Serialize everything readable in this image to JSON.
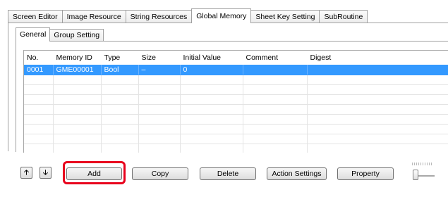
{
  "main_tabs": [
    "Screen Editor",
    "Image Resource",
    "String Resources",
    "Global Memory",
    "Sheet Key Setting",
    "SubRoutine"
  ],
  "active_main_tab": "Global Memory",
  "sub_tabs": [
    "General",
    "Group Setting"
  ],
  "active_sub_tab": "General",
  "grid": {
    "columns": [
      "No.",
      "Memory ID",
      "Type",
      "Size",
      "Initial Value",
      "Comment",
      "Digest"
    ],
    "rows": [
      {
        "no": "0001",
        "memory_id": "GME00001",
        "type": "Bool",
        "size": "–",
        "initial_value": "0",
        "comment": "",
        "digest": ""
      }
    ],
    "selected_row": 0
  },
  "toolbar": {
    "move_up_icon": "arrow-up-icon",
    "move_down_icon": "arrow-down-icon",
    "add_label": "Add",
    "copy_label": "Copy",
    "delete_label": "Delete",
    "action_settings_label": "Action Settings",
    "property_label": "Property"
  },
  "colors": {
    "selection": "#3399ff",
    "highlight": "#e8001c"
  }
}
